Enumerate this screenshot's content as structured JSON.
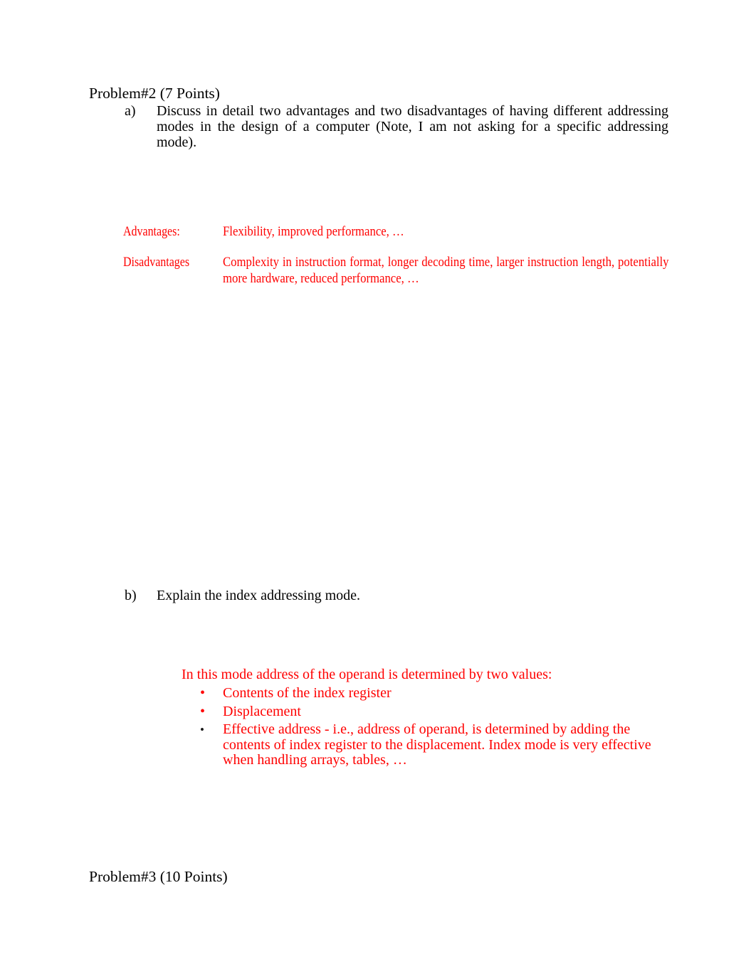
{
  "document": {
    "page_background": "#ffffff",
    "answer_color": "#FF0000",
    "body_color": "#000000"
  },
  "problem2": {
    "heading": "Problem#2 (7 Points)",
    "questions": [
      {
        "marker": "a)",
        "text": "Discuss in detail  two advantages and two disadvantages     of having different addressing modes in the design of a computer (Note, I am not asking for a specific addressing mode)."
      },
      {
        "marker": "b)",
        "text": "Explain the index addressing mode."
      }
    ],
    "answer_a": {
      "advantages_label": "Advantages:",
      "advantages_text": "Flexibility, improved performance, …",
      "disadvantages_label": "Disadvantages",
      "disadvantages_text": "Complexity in instruction format, longer decoding time, larger instruction length, potentially more hardware, reduced performance, …"
    },
    "answer_b": {
      "lead": "In this mode address of the operand  is determined by two values:",
      "bullets": [
        {
          "marker": "•",
          "marker_color": "#FF0000",
          "text": "Contents of the index register"
        },
        {
          "marker": "•",
          "marker_color": "#FF0000",
          "text": "Displacement"
        },
        {
          "marker": "•",
          "marker_color": "#1a1a1a",
          "text": "Effective address  - i.e., address of operand, is determined by adding the contents of index register to the displacement.  Index mode is very effective when handling arrays, tables, …"
        }
      ]
    }
  },
  "problem3": {
    "heading": "Problem#3 (10 Points)"
  }
}
